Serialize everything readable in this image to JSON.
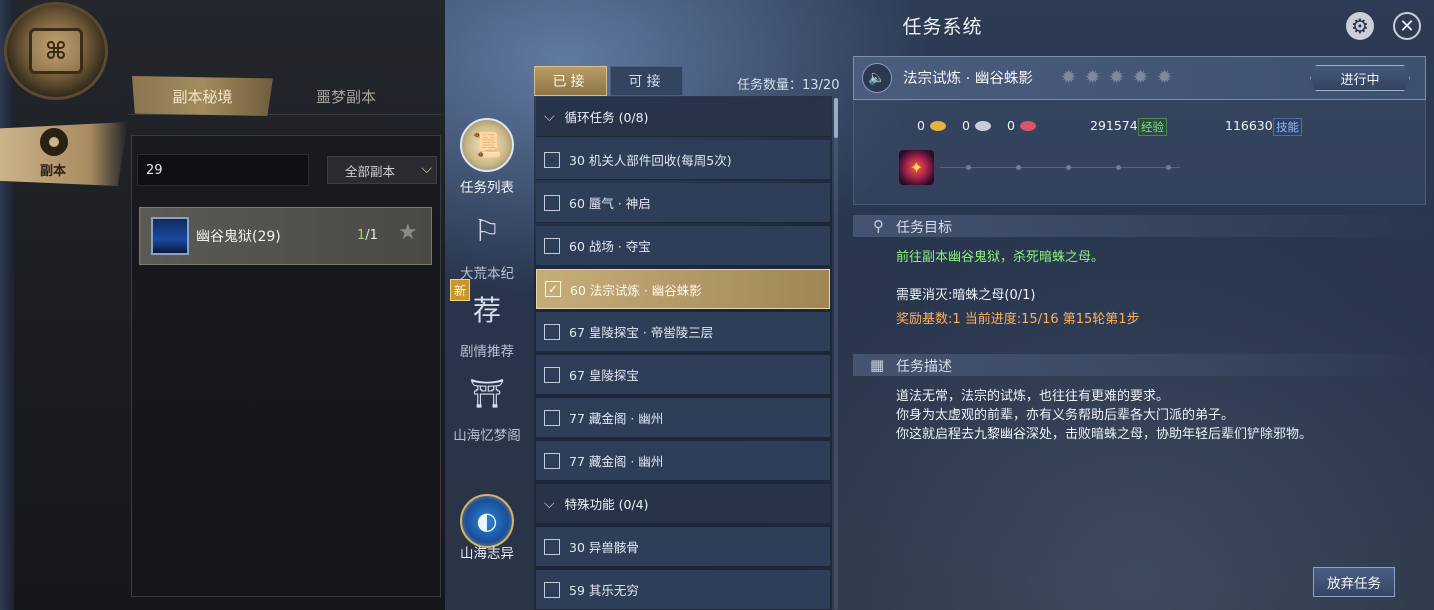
{
  "dungeon_panel": {
    "side_tab_label": "副本",
    "tabs": [
      "副本秘境",
      "噩梦副本"
    ],
    "search_value": "29",
    "filter_selected": "全部副本",
    "dungeon": {
      "name": "幽谷鬼狱(29)",
      "done": "1",
      "total": "/1"
    }
  },
  "window": {
    "title": "任务系统"
  },
  "nav": {
    "task_list": "任务列表",
    "chronicle": "大荒本纪",
    "story_recommend": "剧情推荐",
    "new_badge": "新",
    "story_icon_char": "荐",
    "pavilion": "山海忆梦阁",
    "zhiyi": "山海志异"
  },
  "quest_tabs": {
    "accepted": "已接",
    "available": "可接",
    "count": "任务数量：13/20"
  },
  "quest_list": [
    {
      "type": "category",
      "text": "循环任务 (0/8)"
    },
    {
      "type": "quest",
      "text": "30 机关人部件回收(每周5次)",
      "checked": false
    },
    {
      "type": "quest",
      "text": "60 蜃气 · 神启",
      "checked": false
    },
    {
      "type": "quest",
      "text": "60 战场 · 夺宝",
      "checked": false
    },
    {
      "type": "quest",
      "text": "60 法宗试炼 · 幽谷蛛影",
      "checked": true
    },
    {
      "type": "quest",
      "text": "67 皇陵探宝 · 帝喾陵三层",
      "checked": false
    },
    {
      "type": "quest",
      "text": "67 皇陵探宝",
      "checked": false
    },
    {
      "type": "quest",
      "text": "77 藏金阁 · 幽州",
      "checked": false
    },
    {
      "type": "quest",
      "text": "77 藏金阁 · 幽州",
      "checked": false
    },
    {
      "type": "category",
      "text": "特殊功能 (0/4)"
    },
    {
      "type": "quest",
      "text": "30 异兽骸骨",
      "checked": false
    },
    {
      "type": "quest",
      "text": "59 其乐无穷",
      "checked": false
    }
  ],
  "detail": {
    "title": "法宗试炼 · 幽谷蛛影",
    "status": "进行中",
    "currencies": [
      {
        "value": "0",
        "color": "#e5b43c"
      },
      {
        "value": "0",
        "color": "#c9ced6"
      },
      {
        "value": "0",
        "color": "#d9566a"
      }
    ],
    "exp_value": "291574",
    "exp_label": "经验",
    "skill_value": "116630",
    "skill_label": "技能",
    "goal_title": "任务目标",
    "goal_text": "前往副本幽谷鬼狱，杀死暗蛛之母。",
    "need_text": "需要消灭:暗蛛之母(0/1)",
    "progress_text": "奖励基数:1  当前进度:15/16 第15轮第1步",
    "desc_title": "任务描述",
    "desc_lines": [
      "道法无常，法宗的试炼，也往往有更难的要求。",
      "你身为太虚观的前辈，亦有义务帮助后辈各大门派的弟子。",
      "你这就启程去九黎幽谷深处，击败暗蛛之母，协助年轻后辈们铲除邪物。"
    ],
    "abandon": "放弃任务"
  }
}
